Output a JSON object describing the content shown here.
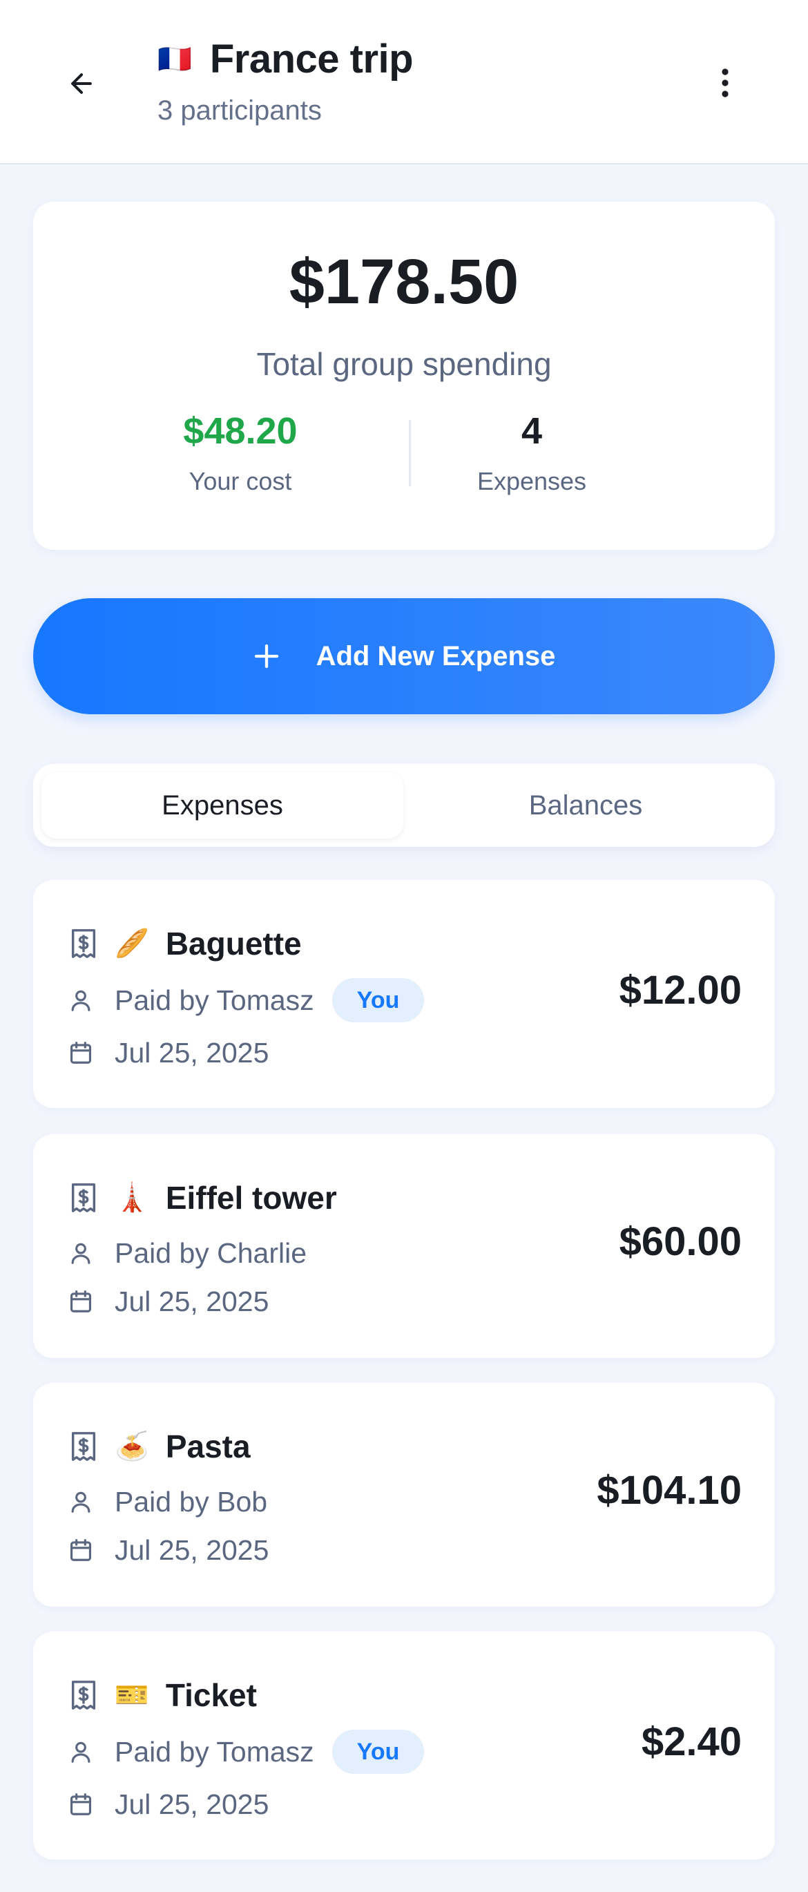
{
  "header": {
    "flag": "🇫🇷",
    "title": "France trip",
    "subtitle": "3 participants"
  },
  "summary": {
    "total": "$178.50",
    "total_label": "Total group spending",
    "your_cost": "$48.20",
    "your_cost_label": "Your cost",
    "expense_count": "4",
    "expense_count_label": "Expenses"
  },
  "add_button": {
    "label": "Add New Expense"
  },
  "tabs": [
    {
      "label": "Expenses",
      "active": true
    },
    {
      "label": "Balances",
      "active": false
    }
  ],
  "expenses": [
    {
      "emoji": "🥖",
      "name": "Baguette",
      "paid_by": "Paid by Tomasz",
      "badge": "You",
      "date": "Jul 25, 2025",
      "amount": "$12.00"
    },
    {
      "emoji": "🗼",
      "name": "Eiffel tower",
      "paid_by": "Paid by Charlie",
      "date": "Jul 25, 2025",
      "amount": "$60.00"
    },
    {
      "emoji": "🍝",
      "name": "Pasta",
      "paid_by": "Paid by Bob",
      "date": "Jul 25, 2025",
      "amount": "$104.10"
    },
    {
      "emoji": "🎫",
      "name": "Ticket",
      "paid_by": "Paid by Tomasz",
      "badge": "You",
      "date": "Jul 25, 2025",
      "amount": "$2.40"
    }
  ],
  "colors": {
    "accent": "#1677ff",
    "positive": "#1fa74a",
    "badge_bg": "#e3effd",
    "muted": "#5b6780"
  },
  "icons": {
    "back": "arrow-left-icon",
    "menu": "more-vertical-icon",
    "add": "plus-icon",
    "receipt": "receipt-dollar-icon",
    "user": "user-icon",
    "calendar": "calendar-icon"
  }
}
